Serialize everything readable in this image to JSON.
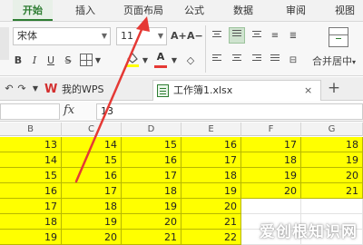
{
  "ribbon_tabs": [
    {
      "label": "开始",
      "active": true
    },
    {
      "label": "插入",
      "active": false
    },
    {
      "label": "页面布局",
      "active": false
    },
    {
      "label": "公式",
      "active": false
    },
    {
      "label": "数据",
      "active": false
    },
    {
      "label": "审阅",
      "active": false
    },
    {
      "label": "视图",
      "active": false
    }
  ],
  "toolbar": {
    "font_name": "宋体",
    "font_size": "11",
    "grow_label": "A+",
    "shrink_label": "A−",
    "bold_label": "B",
    "italic_label": "I",
    "underline_label": "U",
    "font_color_label": "A",
    "merge_label": "合并居中",
    "merge_caret": "▾"
  },
  "doc_tabs": {
    "my_wps": "我的WPS",
    "workbook": "工作簿1.xlsx",
    "close": "×",
    "new_tab": "+"
  },
  "formula_bar": {
    "fx_label": "fx",
    "value": "13"
  },
  "columns": [
    "B",
    "C",
    "D",
    "E",
    "F",
    "G"
  ],
  "rows": [
    [
      "13",
      "14",
      "15",
      "16",
      "17",
      "18"
    ],
    [
      "14",
      "15",
      "16",
      "17",
      "18",
      "19"
    ],
    [
      "15",
      "16",
      "17",
      "18",
      "19",
      "20"
    ],
    [
      "16",
      "17",
      "18",
      "19",
      "20",
      "21"
    ],
    [
      "17",
      "18",
      "19",
      "20",
      "",
      ""
    ],
    [
      "18",
      "19",
      "20",
      "21",
      "",
      ""
    ],
    [
      "19",
      "20",
      "21",
      "22",
      "",
      ""
    ]
  ],
  "colors": {
    "cell_fill": "#ffff00",
    "accent_green": "#2e7d32",
    "annotation_arrow": "#e53935"
  },
  "watermark": "爱创根知识网"
}
